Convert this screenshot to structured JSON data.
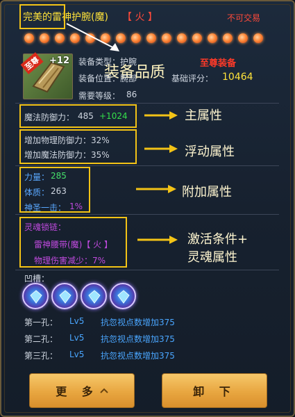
{
  "item": {
    "name": "完美的雷神护腕(魔)",
    "element_tag": "【 火 】",
    "trade_status": "不可交易",
    "tier_label": "至尊装备",
    "icon_badge": "至尊",
    "enhance_level": "+12",
    "type_label": "装备类型：护腕",
    "position_label": "装备位置：腕部",
    "base_score_label": "基础评分：",
    "base_score_value": "10464",
    "level_label": "需要等级：",
    "level_value": "86"
  },
  "main_stat": {
    "label": "魔法防御力：",
    "base": "485",
    "bonus": "+1024"
  },
  "float_stats": [
    {
      "text": "增加物理防御力：32%"
    },
    {
      "text": "增加魔法防御力：35%"
    }
  ],
  "extra_stats": [
    {
      "label": "力量：",
      "value": "285"
    },
    {
      "label": "体质：",
      "value": "263"
    },
    {
      "label": "神圣一击：",
      "value": "1%"
    }
  ],
  "soul_lock": {
    "title": "灵魂锁链：",
    "condition": "雷神腰带(魔)【 火 】",
    "attribute": "物理伤害减少：7%"
  },
  "sockets": {
    "title": "凹槽：",
    "rows": [
      {
        "hole": "第一孔：",
        "level": "Lv5",
        "effect": "抗忽视点数增加375"
      },
      {
        "hole": "第二孔：",
        "level": "Lv5",
        "effect": "抗忽视点数增加375"
      },
      {
        "hole": "第三孔：",
        "level": "Lv5",
        "effect": "抗忽视点数增加375"
      }
    ]
  },
  "buttons": {
    "more": "更 多",
    "unequip": "卸 下"
  },
  "annotations": {
    "quality": "装备品质",
    "main": "主属性",
    "float": "浮动属性",
    "extra": "附加属性",
    "soul_line1": "激活条件+",
    "soul_line2": "灵魂属性"
  },
  "colors": {
    "item_name": "#ffe33a",
    "element_tag": "#ff4a3a",
    "trade_status": "#ff4a3a",
    "tier_label": "#ff3a28",
    "stat_text": "#cfd6e0",
    "bonus_green": "#35e04a",
    "extra_blue": "#5aa8ff",
    "extra_value_green": "#46e06a",
    "soul_purple": "#c04adf",
    "highlight_box": "#f3c316",
    "socket_effect_blue": "#4aa6ff"
  }
}
